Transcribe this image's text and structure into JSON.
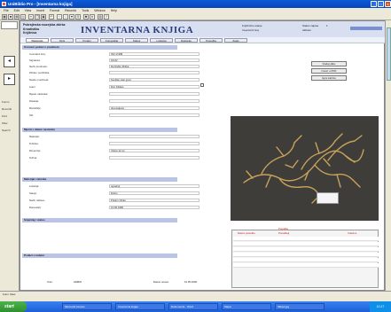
{
  "window": {
    "title": "UniBiblio Pro - [Inventarna knjiga]"
  },
  "menu": [
    "File",
    "Edit",
    "View",
    "Insert",
    "Format",
    "Records",
    "Tools",
    "Window",
    "Help"
  ],
  "navigation": {
    "items": [
      "Forms",
      "Records",
      "Find",
      "Filter",
      "Search"
    ]
  },
  "header": {
    "library": [
      "Pokrajinska muzejska zbirka",
      "Kroatistika",
      "Knjižnica"
    ],
    "title": "INVENTARNA KNJIGA",
    "lookup_label": "Knjižnično stanje",
    "lookup_value": "1",
    "inv_no_label": "Inventarni broj",
    "inv_no_value": "1",
    "status_label": "Status zapisa",
    "status_value": "Aktivan"
  },
  "tabs": [
    "Osnovno",
    "Opis",
    "Podaci",
    "Fotografija",
    "Status",
    "Lokacija",
    "Datoteke",
    "Posudba",
    "Zapis"
  ],
  "sections": {
    "s1": "Osnovni podaci o predmetu",
    "s2": "Mjesto i datum nastanka",
    "s3": "Materijal i tehnika",
    "s4": "Smještaj i status",
    "s5": "Podaci o nabavi"
  },
  "fields": [
    {
      "label": "Inventarni broj:",
      "value": "INV-17489"
    },
    {
      "label": "Signatura:",
      "value": "KZ-02"
    },
    {
      "label": "Naziv predmeta:",
      "value": "Dezirable Zbirka"
    },
    {
      "label": "Zbirka / podzbirka:",
      "value": ""
    },
    {
      "label": "Naslov predmeta:",
      "value": "Svetište stari grad"
    },
    {
      "label": "Autor:",
      "value": "Don čičikan"
    },
    {
      "label": "Mjesto nastanka:",
      "value": ""
    },
    {
      "label": "Datacija:",
      "value": ""
    },
    {
      "label": "Razdoblje:",
      "value": "dva stoljeća"
    },
    {
      "label": "Stil:",
      "value": ""
    },
    {
      "label": "Materijal:",
      "value": ""
    },
    {
      "label": "Tehnika:",
      "value": ""
    },
    {
      "label": "Dimenzije:",
      "value": "Visina 12 cm"
    },
    {
      "label": "Težina:",
      "value": ""
    },
    {
      "label": "Lokacija:",
      "value": "ogradnji"
    },
    {
      "label": "Stanje:",
      "value": "Dobro"
    },
    {
      "label": "Način nabave:",
      "value": "Poklon zbirke"
    },
    {
      "label": "Darovatelj:",
      "value": "13.06.1996"
    }
  ],
  "buttons": {
    "add_image": "Dodaj sliku",
    "export_pdf": "Izvezi u PDF",
    "print": "Ispis kartice"
  },
  "grid": {
    "title": "Posudbe",
    "columns": [
      "Datum posudbe",
      "Posuditelj",
      "Vraćeno"
    ]
  },
  "footer": {
    "label_a": "Unio:",
    "value_a": "ADMIN",
    "label_b": "Datum unosa:",
    "value_b": "12.05.2006"
  },
  "status": {
    "text": "Form View"
  },
  "taskbar": {
    "start": "start",
    "tasks": [
      "Microsoft Access",
      "Inventarna knjiga",
      "Dokument1 - Word",
      "Mapa",
      "Slika1.jpg"
    ],
    "clock": "10:17"
  }
}
